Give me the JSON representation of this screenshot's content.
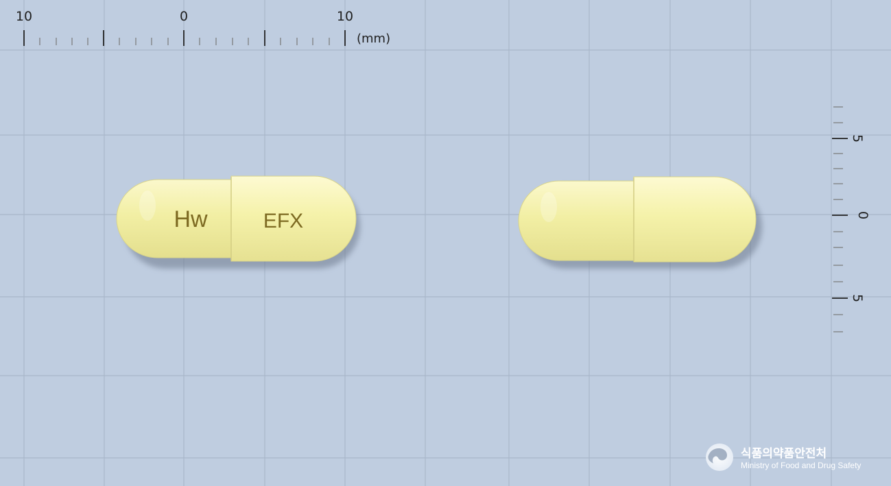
{
  "ruler_top": {
    "labels": [
      "10",
      "0",
      "10"
    ],
    "unit": "(mm)"
  },
  "ruler_right": {
    "labels": [
      "5",
      "0",
      "5"
    ]
  },
  "capsule_front": {
    "imprint_left": "Hw",
    "imprint_right": "EFX"
  },
  "logo": {
    "korean": "식품의약품안전처",
    "english": "Ministry of Food and Drug Safety"
  },
  "colors": {
    "background": "#bfcde0",
    "grid": "#a8b6c9",
    "capsule": "#f3f0a6",
    "imprint": "#7d6a22"
  }
}
